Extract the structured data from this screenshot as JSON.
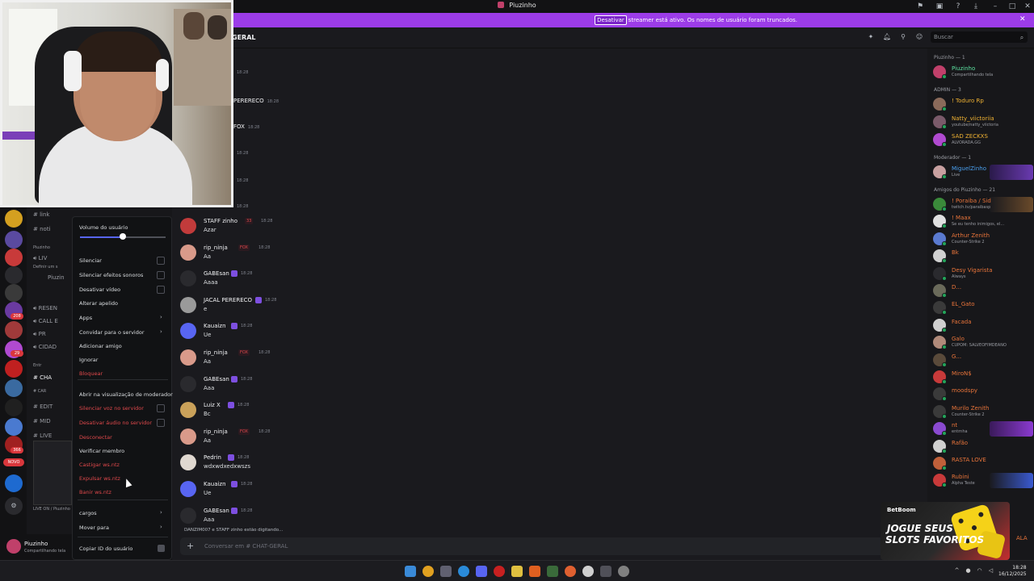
{
  "window": {
    "title": "Piuzinho"
  },
  "banner": {
    "text": "O modo streamer está ativo. Os nomes de usuário foram truncados.",
    "button": "Desativar"
  },
  "header": {
    "channel": "GERAL",
    "search_placeholder": "Buscar"
  },
  "servers": {
    "badges": [
      "208",
      "29",
      "366"
    ],
    "novo": "NOVO"
  },
  "channels": {
    "rows": [
      "link",
      "noti",
      "Piuzinho",
      "LIV",
      "Definir um s",
      "Piuzin",
      "RESEN",
      "CALL E",
      "PR",
      "CIDAD",
      "Entr",
      "CHA",
      "CAR",
      "EDIT",
      "MID",
      "LIVE"
    ],
    "bottom_label": "LIVE ON / Piuzinho"
  },
  "context_menu": {
    "volume_label": "Volume do usuário",
    "volume_percent": 50,
    "items": [
      {
        "label": "Silenciar",
        "kind": "check"
      },
      {
        "label": "Silenciar efeitos sonoros",
        "kind": "check"
      },
      {
        "label": "Desativar vídeo",
        "kind": "check"
      },
      {
        "label": "Alterar apelido",
        "kind": "plain"
      },
      {
        "label": "Apps",
        "kind": "sub"
      },
      {
        "label": "Convidar para o servidor",
        "kind": "sub"
      },
      {
        "label": "Adicionar amigo",
        "kind": "plain"
      },
      {
        "label": "Ignorar",
        "kind": "plain"
      },
      {
        "label": "Bloquear",
        "kind": "red"
      },
      {
        "label": "Abrir na visualização de moderador",
        "kind": "plain"
      },
      {
        "label": "Silenciar voz no servidor",
        "kind": "redcheck"
      },
      {
        "label": "Desativar áudio no servidor",
        "kind": "redcheck"
      },
      {
        "label": "Desconectar",
        "kind": "red"
      },
      {
        "label": "Verificar membro",
        "kind": "plain"
      },
      {
        "label": "Castigar ws.ntz",
        "kind": "red"
      },
      {
        "label": "Expulsar ws.ntz",
        "kind": "red"
      },
      {
        "label": "Banir ws.ntz",
        "kind": "red"
      },
      {
        "label": "cargos",
        "kind": "sub"
      },
      {
        "label": "Mover para",
        "kind": "sub"
      },
      {
        "label": "Copiar ID do usuário",
        "kind": "id"
      }
    ]
  },
  "chat": {
    "top_fragments": [
      {
        "name": "",
        "time": "18:28"
      },
      {
        "name": "PERERECO",
        "time": "18:28"
      },
      {
        "name": "FOX",
        "time": "18:28"
      },
      {
        "name": "",
        "time": "18:28"
      },
      {
        "name": "",
        "time": "18:28"
      },
      {
        "name": "",
        "time": "18:28"
      }
    ],
    "messages": [
      {
        "name": "STAFF zinho",
        "tag": "33",
        "time": "18:28",
        "text": "Azar",
        "avatar_color": "#c23b3b"
      },
      {
        "name": "rip_ninja",
        "tag": "FOX",
        "time": "18:28",
        "text": "Aa",
        "avatar_color": "#d99a8a"
      },
      {
        "name": "GABEsan",
        "tag": "",
        "time": "18:28",
        "text": "Aaaa",
        "avatar_color": "#2a2a2e"
      },
      {
        "name": "JACAL PERERECO",
        "tag": "",
        "time": "18:28",
        "text": "e",
        "avatar_color": "#9a9a9a"
      },
      {
        "name": "Kauaizn",
        "tag": "",
        "time": "18:28",
        "text": "Ue",
        "avatar_color": "#5865f2"
      },
      {
        "name": "rip_ninja",
        "tag": "FOX",
        "time": "18:28",
        "text": "Aa",
        "avatar_color": "#d99a8a"
      },
      {
        "name": "GABEsan",
        "tag": "",
        "time": "18:28",
        "text": "Aaa",
        "avatar_color": "#2a2a2e"
      },
      {
        "name": "Luiz X",
        "tag": "",
        "time": "18:28",
        "text": "Bc",
        "avatar_color": "#caa15a"
      },
      {
        "name": "rip_ninja",
        "tag": "FOX",
        "time": "18:28",
        "text": "Aa",
        "avatar_color": "#d99a8a"
      },
      {
        "name": "Pedrin",
        "tag": "",
        "time": "18:28",
        "text": "wdxwdxedxwszs",
        "avatar_color": "#e0d8d0"
      },
      {
        "name": "Kauaizn",
        "tag": "",
        "time": "18:28",
        "text": "Ue",
        "avatar_color": "#5865f2"
      },
      {
        "name": "GABEsan",
        "tag": "",
        "time": "18:28",
        "text": "Aaa",
        "avatar_color": "#2a2a2e"
      }
    ],
    "typing": "DANZIM007 e STAFF zinho estão digitando...",
    "composer_placeholder": "Conversar em # CHAT-GERAL"
  },
  "members": {
    "groups": [
      {
        "title": "Piuzinho — 1",
        "members": [
          {
            "name": "Piuzinho",
            "sub": "Compartilhando tela",
            "color": "#5ce0a0",
            "av": "#c0406a"
          }
        ]
      },
      {
        "title": "ADMIN — 3",
        "members": [
          {
            "name": "! Toduro Rp",
            "sub": "",
            "color": "#f0b232",
            "av": "#8a6a5a"
          },
          {
            "name": "Natty_viictoriia",
            "sub": "youtube/natty_viictoria",
            "color": "#f0b232",
            "av": "#7a5a6a"
          },
          {
            "name": "SAD ZECKXS",
            "sub": "ALVORADA.GG",
            "color": "#f0b232",
            "av": "#b04ad0"
          }
        ]
      },
      {
        "title": "Moderador — 1",
        "members": [
          {
            "name": "MiguelZinho",
            "sub": "Live",
            "color": "#4aa0f0",
            "av": "#c8a0a0"
          }
        ]
      },
      {
        "title": "Amigos do Piuzinho — 21",
        "members": [
          {
            "name": "! Poraiba / Sid",
            "sub": "twitch.tv/paraibasp",
            "color": "#e8743a",
            "av": "#3a8a3a"
          },
          {
            "name": "! Maax",
            "sub": "Se eu tenho inimigos, el...",
            "color": "#e8743a",
            "av": "#e0e0e0"
          },
          {
            "name": "Arthur Zenith",
            "sub": "Counter-Strike 2",
            "color": "#e8743a",
            "av": "#5a7ad0"
          },
          {
            "name": "Bk",
            "sub": "",
            "color": "#e8743a",
            "av": "#d0d0d0"
          },
          {
            "name": "Desy Vigarista",
            "sub": "Always",
            "color": "#e8743a",
            "av": "#2a2a2e"
          },
          {
            "name": "D...",
            "sub": "",
            "color": "#e8743a",
            "av": "#6a6a5a"
          },
          {
            "name": "EL_Gato",
            "sub": "",
            "color": "#e8743a",
            "av": "#3a3a3a"
          },
          {
            "name": "Facada",
            "sub": "",
            "color": "#e8743a",
            "av": "#d0d0d0"
          },
          {
            "name": "Galo",
            "sub": "CUPOM: SALVEOFIMDEANO",
            "color": "#e8743a",
            "av": "#b08a7a"
          },
          {
            "name": "G...",
            "sub": "",
            "color": "#e8743a",
            "av": "#5a4a3a"
          },
          {
            "name": "MiroN$",
            "sub": "",
            "color": "#e8743a",
            "av": "#c83a3a"
          },
          {
            "name": "moodspy",
            "sub": "",
            "color": "#e8743a",
            "av": "#3a3a3a"
          },
          {
            "name": "Murilo Zenith",
            "sub": "Counter-Strike 2",
            "color": "#e8743a",
            "av": "#3a3a3a"
          },
          {
            "name": "nt",
            "sub": "entrnha",
            "color": "#e8743a",
            "av": "#8a4ad0"
          },
          {
            "name": "Rafão",
            "sub": "",
            "color": "#e8743a",
            "av": "#d0d0d0"
          },
          {
            "name": "RASTA LOVE",
            "sub": "",
            "color": "#e8743a",
            "av": "#c0603a"
          },
          {
            "name": "Rubini",
            "sub": "Alpha Teste",
            "color": "#e8743a",
            "av": "#c83a3a"
          }
        ]
      }
    ],
    "cut_name": "ALA"
  },
  "ad": {
    "brand": "BetBoom",
    "line1": "JOGUE SEUS",
    "line2": "SLOTS FAVORITOS"
  },
  "user_panel": {
    "name": "Piuzinho",
    "status": "Compartilhando tela"
  },
  "taskbar": {
    "time": "18:28",
    "date": "16/12/2025"
  },
  "colors": {
    "accent": "#5865f2",
    "banner": "#9c3ce8",
    "danger": "#e0484b"
  }
}
